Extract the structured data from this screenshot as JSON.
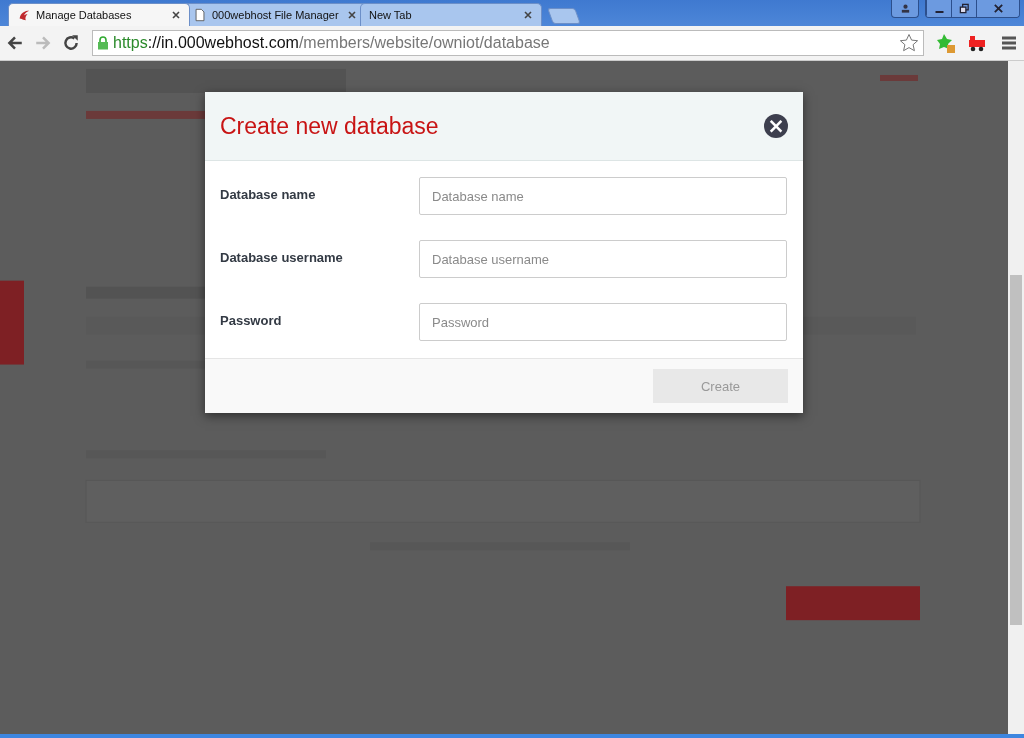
{
  "browser": {
    "tabs": [
      {
        "label": "Manage Databases",
        "selected": true,
        "kind": "site"
      },
      {
        "label": "000webhost File Manager",
        "selected": false,
        "kind": "page"
      },
      {
        "label": "New Tab",
        "selected": false,
        "kind": "none"
      }
    ],
    "address": {
      "scheme": "https",
      "host": "://in.000webhost.com",
      "path": "/members/website/owniot/database"
    }
  },
  "dialog": {
    "title": "Create new database",
    "close": "×",
    "fields": [
      {
        "label": "Database name",
        "placeholder": "Database name"
      },
      {
        "label": "Database username",
        "placeholder": "Database username"
      },
      {
        "label": "Password",
        "placeholder": "Password"
      }
    ],
    "button": {
      "label": "Create",
      "disabled": true
    }
  }
}
